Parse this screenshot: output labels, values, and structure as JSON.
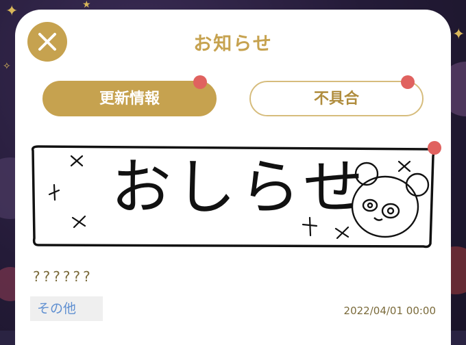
{
  "dialog": {
    "title": "お知らせ",
    "close_icon": "close-icon"
  },
  "tabs": [
    {
      "label": "更新情報",
      "active": true,
      "has_notification_dot": true
    },
    {
      "label": "不具合",
      "active": false,
      "has_notification_dot": true
    }
  ],
  "notice": {
    "banner_text": "おしらせ",
    "has_notification_dot": true,
    "body": "??????",
    "category": "その他",
    "date": "2022/04/01 00:00"
  },
  "colors": {
    "accent_gold": "#c6a24f",
    "notification_red": "#e0625f",
    "category_blue": "#5f8fd1"
  }
}
